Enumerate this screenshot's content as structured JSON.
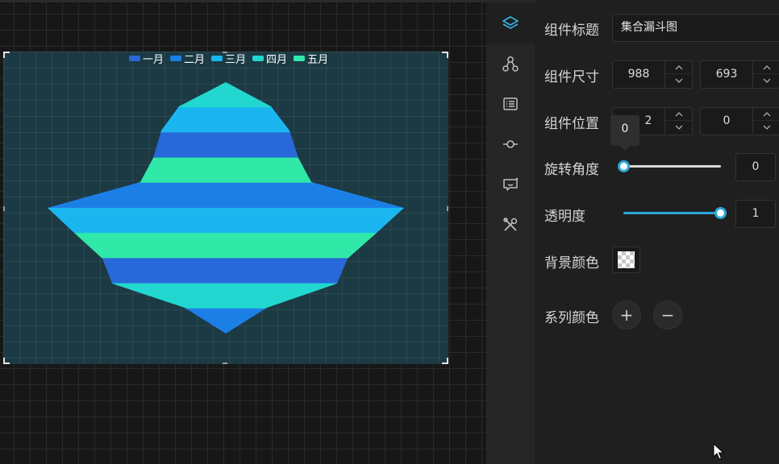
{
  "canvas": {
    "chart_data": {
      "type": "funnel",
      "legend": [
        "一月",
        "二月",
        "三月",
        "四月",
        "五月"
      ],
      "legend_colors": [
        "#2868d8",
        "#1c7fe6",
        "#1bb6ef",
        "#22d7cf",
        "#30e9a8"
      ],
      "legend_placement": "top",
      "stripe_colors_top_to_bottom": [
        "#22d7cf",
        "#1bb6ef",
        "#2868d8",
        "#30e9a8",
        "#1c7fe6",
        "#1bb6ef",
        "#30e9a8",
        "#2868d8",
        "#22d7cf",
        "#1c7fe6"
      ]
    }
  },
  "panel": {
    "rail_icons": [
      "layers-icon",
      "nodes-icon",
      "list-icon",
      "connector-icon",
      "message-icon",
      "tools-icon"
    ],
    "title_label": "组件标题",
    "title_value": "集合漏斗图",
    "size_label": "组件尺寸",
    "size_width": "988",
    "size_height": "693",
    "position_label": "组件位置",
    "position_x": "2",
    "position_y": "0",
    "rotation_label": "旋转角度",
    "rotation_tooltip": "0",
    "rotation_value": "0",
    "opacity_label": "透明度",
    "opacity_value": "1",
    "opacity_level": 1,
    "bg_color_label": "背景颜色",
    "series_color_label": "系列颜色",
    "add_symbol": "+",
    "remove_symbol": "−"
  }
}
